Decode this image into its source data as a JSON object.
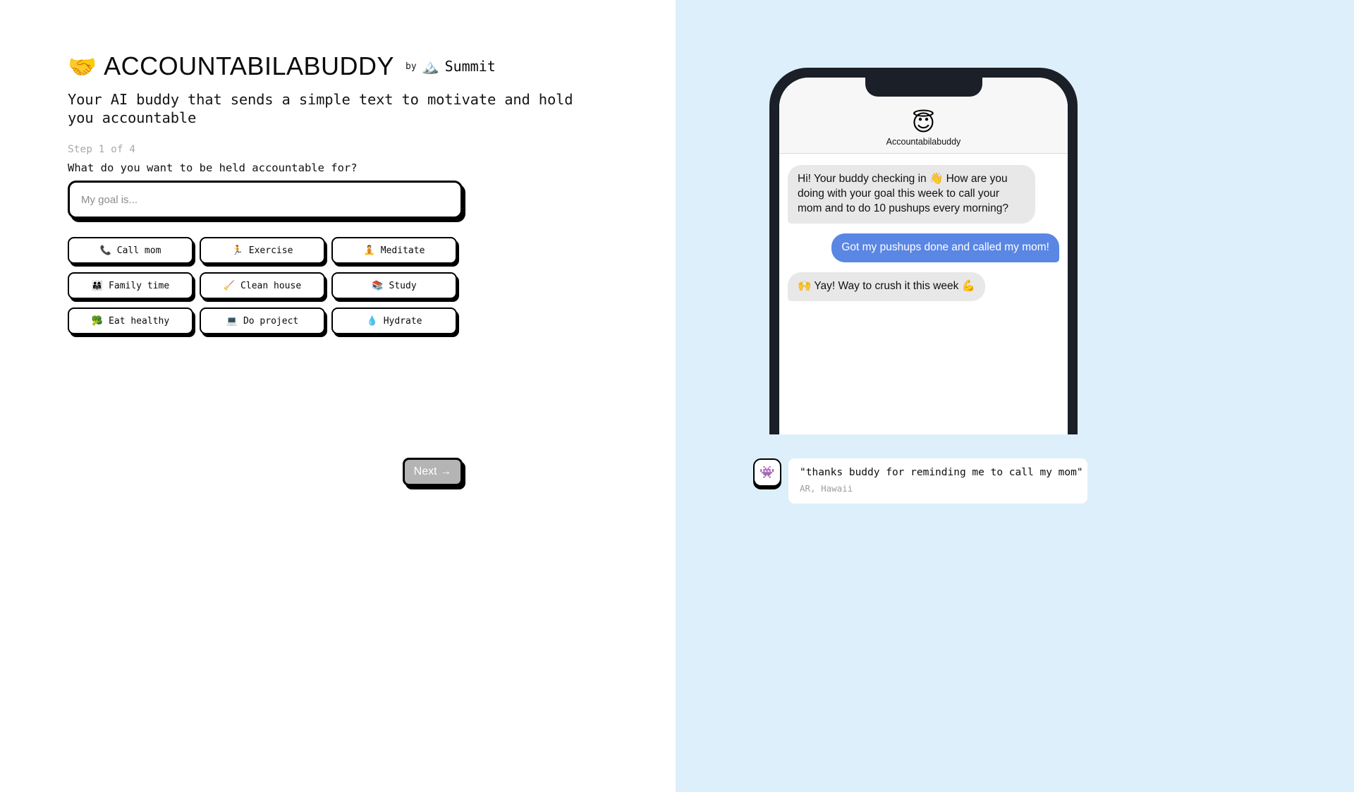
{
  "brand": {
    "logo_emoji": "🤝",
    "title": "ACCOUNTABILABUDDY",
    "by_label": "by",
    "partner_emoji": "🏔️",
    "partner_name": "Summit"
  },
  "tagline": "Your AI buddy that sends a simple text to motivate and hold you accountable",
  "form": {
    "step_label": "Step 1 of 4",
    "question": "What do you want to be held accountable for?",
    "goal_value": "",
    "goal_placeholder": "My goal is...",
    "chips": [
      {
        "emoji": "📞",
        "label": "Call mom"
      },
      {
        "emoji": "🏃",
        "label": "Exercise"
      },
      {
        "emoji": "🧘",
        "label": "Meditate"
      },
      {
        "emoji": "👨‍👩‍👧",
        "label": "Family time"
      },
      {
        "emoji": "🧹",
        "label": "Clean house"
      },
      {
        "emoji": "📚",
        "label": "Study"
      },
      {
        "emoji": "🥦",
        "label": "Eat healthy"
      },
      {
        "emoji": "💻",
        "label": "Do project"
      },
      {
        "emoji": "💧",
        "label": "Hydrate"
      }
    ],
    "next_label": "Next →"
  },
  "phone": {
    "buddy_avatar_emoji": "😇",
    "buddy_name": "Accountabilabuddy",
    "messages": [
      {
        "direction": "in",
        "text": "Hi! Your buddy checking in 👋 How are you doing with your goal this week to call your mom and to do 10 pushups every morning?"
      },
      {
        "direction": "out",
        "text": "Got my pushups done and called my mom!"
      },
      {
        "direction": "in",
        "text": "🙌 Yay!  Way to crush it this week 💪"
      }
    ]
  },
  "testimonial": {
    "avatar_emoji": "👾",
    "quote": "\"thanks buddy for reminding me to call my mom\"",
    "author": "AR, Hawaii"
  },
  "colors": {
    "right_panel_bg": "#deeffc",
    "bubble_in": "#e8e8e8",
    "bubble_out": "#5a86e4",
    "phone_bezel": "#1b1f28",
    "next_disabled": "#b4b4b4"
  }
}
